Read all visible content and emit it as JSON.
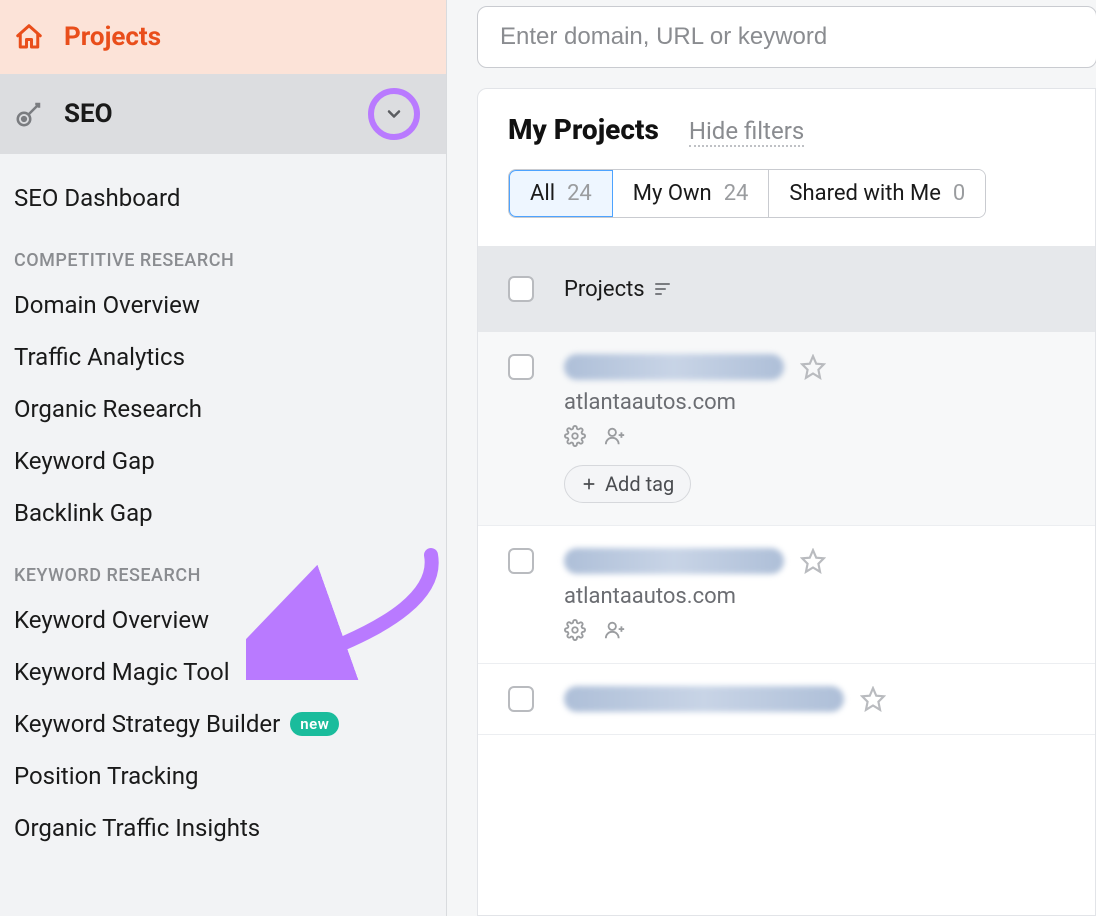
{
  "sidebar": {
    "projects_label": "Projects",
    "seo_label": "SEO",
    "nav": {
      "dashboard": "SEO Dashboard",
      "section_competitive": "COMPETITIVE RESEARCH",
      "domain_overview": "Domain Overview",
      "traffic_analytics": "Traffic Analytics",
      "organic_research": "Organic Research",
      "keyword_gap": "Keyword Gap",
      "backlink_gap": "Backlink Gap",
      "section_keyword": "KEYWORD RESEARCH",
      "keyword_overview": "Keyword Overview",
      "keyword_magic": "Keyword Magic Tool",
      "keyword_strategy": "Keyword Strategy Builder",
      "keyword_strategy_badge": "new",
      "position_tracking": "Position Tracking",
      "organic_insights": "Organic Traffic Insights"
    }
  },
  "search": {
    "placeholder": "Enter domain, URL or keyword"
  },
  "panel": {
    "title": "My Projects",
    "hide_filters": "Hide filters",
    "tabs": {
      "all_label": "All",
      "all_count": "24",
      "own_label": "My Own",
      "own_count": "24",
      "shared_label": "Shared with Me",
      "shared_count": "0"
    },
    "columns": {
      "projects": "Projects"
    },
    "rows": [
      {
        "subtitle": "atlantaautos.com",
        "add_tag": "Add tag"
      },
      {
        "subtitle": "atlantaautos.com"
      },
      {
        "subtitle": ""
      }
    ]
  },
  "colors": {
    "accent_orange": "#e94e1b",
    "annotation_purple": "#b97aff"
  }
}
